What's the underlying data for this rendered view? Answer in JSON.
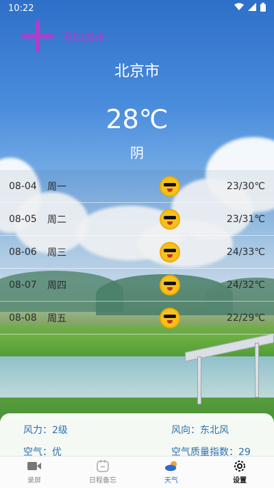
{
  "status_bar": {
    "time": "10:22"
  },
  "add_city": {
    "label": "添加城市"
  },
  "weather": {
    "city": "北京市",
    "temperature": "28℃",
    "condition": "阴"
  },
  "forecast": [
    {
      "date": "08-04",
      "weekday": "周一",
      "icon": "sun-sunglasses-icon",
      "range": "23/30℃"
    },
    {
      "date": "08-05",
      "weekday": "周二",
      "icon": "sun-sunglasses-icon",
      "range": "23/31℃"
    },
    {
      "date": "08-06",
      "weekday": "周三",
      "icon": "sun-sunglasses-icon",
      "range": "24/33℃"
    },
    {
      "date": "08-07",
      "weekday": "周四",
      "icon": "sun-sunglasses-icon",
      "range": "24/32℃"
    },
    {
      "date": "08-08",
      "weekday": "周五",
      "icon": "sun-sunglasses-icon",
      "range": "22/29℃"
    }
  ],
  "details": {
    "wind_power": "风力：2级",
    "wind_direction": "风向：东北风",
    "air_quality": "空气：优",
    "aqi": "空气质量指数：29"
  },
  "tabs": [
    {
      "label": "录屏",
      "icon": "video-icon"
    },
    {
      "label": "日程备忘",
      "icon": "calendar-icon"
    },
    {
      "label": "天气",
      "icon": "weather-icon"
    },
    {
      "label": "设置",
      "icon": "gear-icon"
    }
  ],
  "colors": {
    "accent": "#b43cc8",
    "detail_text": "#2f6fb0",
    "tab_active": "#2e6cc8"
  }
}
